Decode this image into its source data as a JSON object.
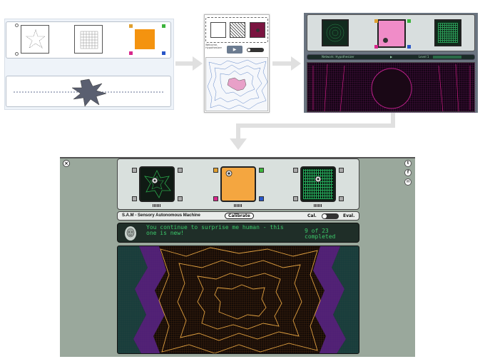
{
  "stage2": {
    "message": "Welcome, Hypothesizer",
    "play_icon": "play-icon"
  },
  "stage3": {
    "status_text": "Network: Hypothesizer",
    "level_text": "Level 1"
  },
  "app": {
    "close_icon": "close-icon",
    "social": [
      {
        "name": "twitter-icon",
        "glyph": "t"
      },
      {
        "name": "facebook-icon",
        "glyph": "f"
      },
      {
        "name": "email-icon",
        "glyph": "✉"
      }
    ],
    "machine_name": "S.A.M - Sensory Autonomous Machine",
    "calibrate_label": "Calibrate",
    "mode_cal": "Cal.",
    "mode_eval": "Eval.",
    "message": "You continue to surprise me human - this one is new!",
    "progress_text": "9 of 23 completed",
    "progress": {
      "completed": 9,
      "total": 23
    }
  },
  "colors": {
    "orange": "#f4a640",
    "green_text": "#3cc86a",
    "magenta": "#e21f8e",
    "pink": "#f08cc8",
    "purple": "#6b2d8a"
  }
}
